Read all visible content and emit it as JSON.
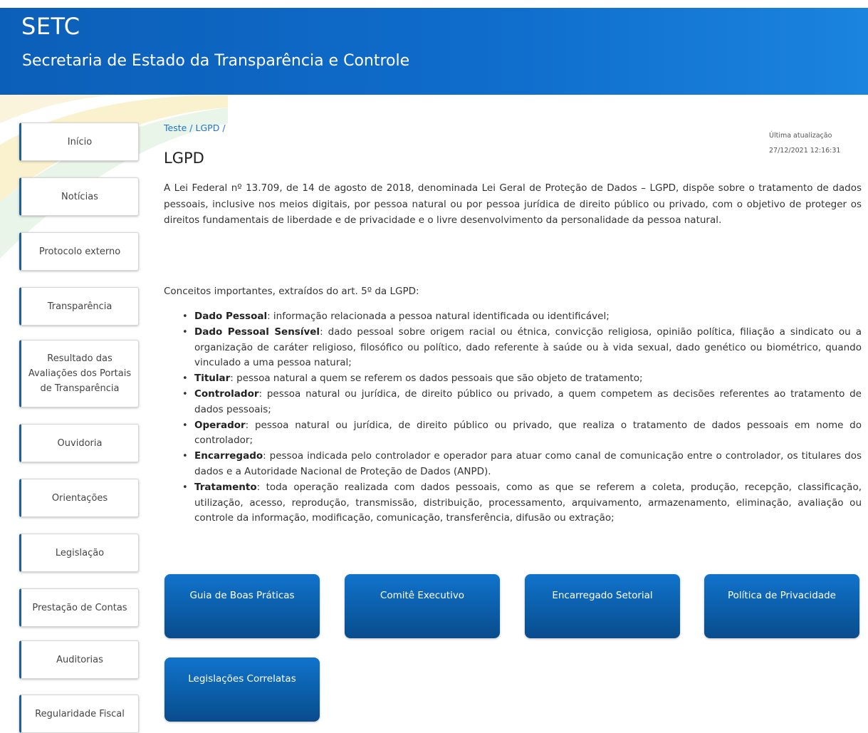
{
  "header": {
    "brand": "SETC",
    "subtitle": "Secretaria de Estado da Transparência e Controle"
  },
  "sidebar": {
    "items": [
      {
        "label": "Início"
      },
      {
        "label": "Notícias"
      },
      {
        "label": "Protocolo externo"
      },
      {
        "label": "Transparência"
      },
      {
        "label": "Resultado das Avaliações dos Portais de Transparência"
      },
      {
        "label": "Ouvidoria"
      },
      {
        "label": "Orientações"
      },
      {
        "label": "Legislação"
      },
      {
        "label": "Prestação de Contas"
      },
      {
        "label": "Auditorias"
      },
      {
        "label": "Regularidade Fiscal"
      }
    ]
  },
  "breadcrumb": {
    "items": [
      "Teste",
      "LGPD"
    ],
    "separator": "/"
  },
  "last_update": {
    "label": "Última atualização",
    "value": "27/12/2021 12:16:31"
  },
  "page": {
    "title": "LGPD",
    "intro": "A Lei Federal nº 13.709, de 14 de agosto de 2018, denominada Lei Geral de Proteção de Dados – LGPD, dispõe sobre o tratamento de dados pessoais, inclusive nos meios digitais, por pessoa natural ou por pessoa jurídica de direito público ou privado, com o objetivo de proteger os direitos fundamentais de liberdade e de privacidade e o livre desenvolvimento da personalidade da pessoa natural.",
    "concepts_label": "Conceitos importantes, extraídos do art. 5º da LGPD:",
    "concepts": [
      {
        "term": "Dado Pessoal",
        "definition": ": informação relacionada a pessoa natural identificada ou identificável;"
      },
      {
        "term": "Dado Pessoal Sensível",
        "definition": ": dado pessoal sobre origem racial ou étnica, convicção religiosa, opinião política, filiação a sindicato ou a organização de caráter religioso, filosófico ou político, dado  referente à saúde ou à vida sexual, dado genético ou biométrico, quando vinculado a uma pessoa natural;"
      },
      {
        "term": "Titular",
        "definition": ": pessoa natural a quem se referem os dados pessoais que são objeto de tratamento;"
      },
      {
        "term": "Controlador",
        "definition": ": pessoa natural ou jurídica, de direito público ou privado, a quem competem as decisões referentes ao tratamento de dados pessoais;"
      },
      {
        "term": "Operador",
        "definition": ": pessoa natural ou jurídica, de direito público ou privado, que realiza o tratamento de dados pessoais em nome do controlador;"
      },
      {
        "term": "Encarregado",
        "definition": ": pessoa indicada pelo controlador e operador para atuar como canal de comunicação entre o controlador, os titulares dos dados e a Autoridade Nacional de Proteção de Dados (ANPD)."
      },
      {
        "term": "Tratamento",
        "definition": ": toda operação realizada com dados pessoais, como as que se referem a coleta, produção, recepção, classificação, utilização, acesso, reprodução, transmissão, distribuição, processamento, arquivamento, armazenamento, eliminação, avaliação ou controle da informação, modificação, comunicação, transferência, difusão ou extração;"
      }
    ]
  },
  "tiles": [
    {
      "label": "Guia de Boas Práticas"
    },
    {
      "label": "Comitê Executivo"
    },
    {
      "label": "Encarregado Setorial"
    },
    {
      "label": "Política de Privacidade"
    },
    {
      "label": "Legislações Correlatas"
    }
  ],
  "colors": {
    "header": "#0f6ccb",
    "tile": "#0b5ea9",
    "link": "#1e73c8",
    "nav_accent": "#1e5f9c"
  }
}
